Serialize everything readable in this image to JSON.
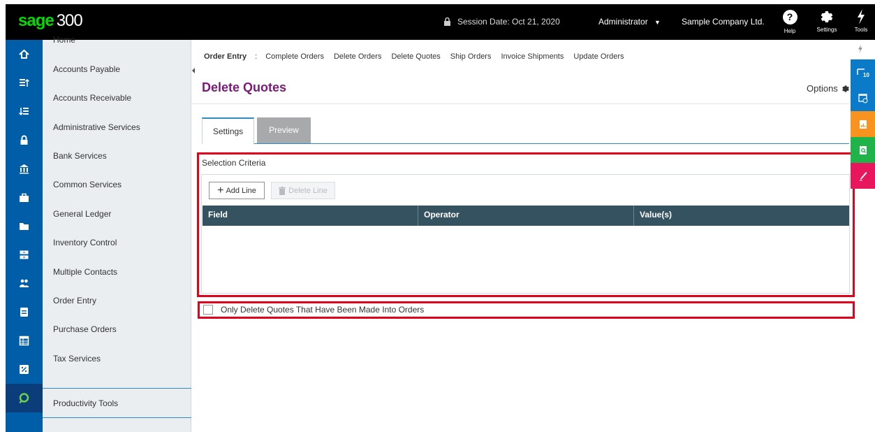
{
  "brand": {
    "logo": "sage",
    "version": "300"
  },
  "topbar": {
    "session_label": "Session Date:  Oct 21, 2020",
    "user": "Administrator",
    "company": "Sample Company Ltd.",
    "help_label": "Help",
    "settings_label": "Settings",
    "tools_label": "Tools"
  },
  "sidebar": {
    "items": [
      {
        "label": "Home",
        "icon": "home-icon"
      },
      {
        "label": "Accounts Payable",
        "icon": "accounts-payable-icon"
      },
      {
        "label": "Accounts Receivable",
        "icon": "accounts-receivable-icon"
      },
      {
        "label": "Administrative Services",
        "icon": "lock-icon"
      },
      {
        "label": "Bank Services",
        "icon": "bank-icon"
      },
      {
        "label": "Common Services",
        "icon": "briefcase-icon"
      },
      {
        "label": "General Ledger",
        "icon": "folder-icon"
      },
      {
        "label": "Inventory Control",
        "icon": "inventory-icon"
      },
      {
        "label": "Multiple Contacts",
        "icon": "contacts-icon"
      },
      {
        "label": "Order Entry",
        "icon": "order-entry-icon"
      },
      {
        "label": "Purchase Orders",
        "icon": "purchase-orders-icon"
      },
      {
        "label": "Tax Services",
        "icon": "tax-icon"
      },
      {
        "label": "Productivity Tools",
        "icon": "productivity-icon"
      }
    ]
  },
  "breadcrumb": {
    "root": "Order Entry",
    "separator": ":",
    "links": [
      "Complete Orders",
      "Delete Orders",
      "Delete Quotes",
      "Ship Orders",
      "Invoice Shipments",
      "Update Orders"
    ]
  },
  "page": {
    "title": "Delete Quotes",
    "options_label": "Options"
  },
  "tabs": [
    {
      "label": "Settings",
      "active": true
    },
    {
      "label": "Preview",
      "active": false
    }
  ],
  "criteria": {
    "label": "Selection Criteria",
    "add_line": "Add Line",
    "delete_line": "Delete Line",
    "columns": [
      "Field",
      "Operator",
      "Value(s)"
    ]
  },
  "only_delete_option": {
    "label": "Only Delete Quotes That Have Been Made Into Orders",
    "checked": false
  },
  "colors": {
    "brand_green": "#00dc00",
    "rail_blue": "#005ea8",
    "title_purple": "#7b1a7a",
    "grid_header": "#34525f",
    "highlight_red": "#e3001b",
    "tool_blue": "#0a7ac9",
    "tool_orange": "#f7931e",
    "tool_green": "#1fb34a",
    "tool_pink": "#e8175d"
  }
}
